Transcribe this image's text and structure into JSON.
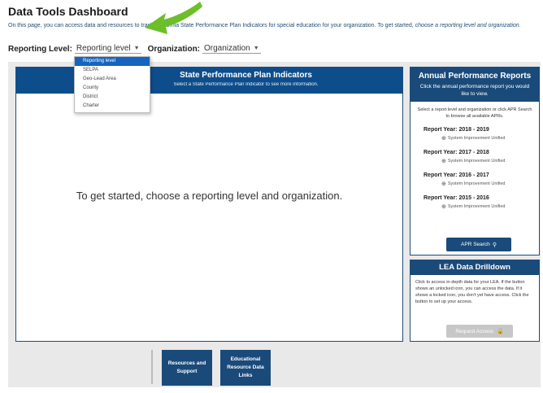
{
  "page": {
    "title": "Data Tools Dashboard",
    "intro_line1": "On this page, you can access data and resources to track California State Performance Plan Indicators for special education for your organization. To get started,",
    "intro_line2": "choose a reporting level and organization."
  },
  "filters": {
    "reporting_label": "Reporting Level:",
    "reporting_value": "Reporting level",
    "organization_label": "Organization:",
    "organization_value": "Organization"
  },
  "dropdown": {
    "options": [
      "Reporting level",
      "SELPA",
      "Geo-Lead Area",
      "County",
      "District",
      "Charter"
    ],
    "selected_index": 0
  },
  "main_panel": {
    "header": "State Performance Plan Indicators",
    "subheader": "Select a State Performance Plan Indicator to see more information.",
    "placeholder": "To get started, choose a reporting level and organization."
  },
  "apr_panel": {
    "header": "Annual Performance Reports",
    "subheader": "Click the annual performance report you would like to view.",
    "intro": "Select a report level and organization or click APR Search to browse all available APRs.",
    "reports": [
      {
        "year": "Report Year: 2018 - 2019",
        "link": "System Improvement Unified"
      },
      {
        "year": "Report Year: 2017 - 2018",
        "link": "System Improvement Unified"
      },
      {
        "year": "Report Year: 2016 - 2017",
        "link": "System Improvement Unified"
      },
      {
        "year": "Report Year: 2015 - 2016",
        "link": "System Improvement Unified"
      }
    ],
    "search_button": "APR Search"
  },
  "lea_panel": {
    "header": "LEA Data Drilldown",
    "body": "Click to access in-depth data for your LEA. If the button shows an unlocked icon, you can access the data. If it shows a locked icon, you don't yet have access. Click the button to set up your access.",
    "request_button": "Request Access"
  },
  "bottom_buttons": {
    "resources": "Resources and Support",
    "educational": "Educational Resource Data Links"
  },
  "colors": {
    "header_blue": "#0e4d8c",
    "panel_blue": "#1a4a7a",
    "accent_green": "#6cbf2a",
    "dropdown_active": "#1565c0"
  }
}
